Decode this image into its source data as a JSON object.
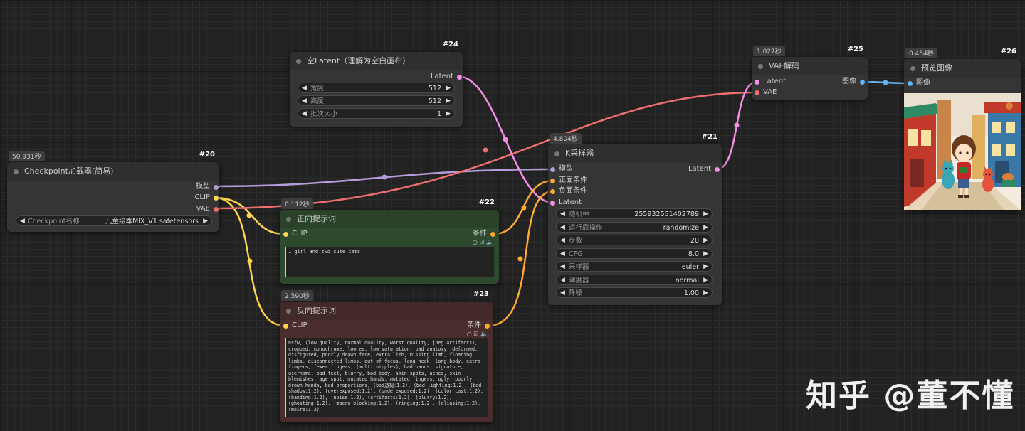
{
  "nodes": {
    "checkpoint": {
      "id": "#20",
      "time": "50.931秒",
      "title": "Checkpoint加载器(简易)",
      "outputs": [
        "模型",
        "CLIP",
        "VAE"
      ],
      "widget": {
        "label": "Checkpoint名称",
        "value": "儿童绘本MIX_V1.safetensors"
      }
    },
    "empty_latent": {
      "id": "#24",
      "title": "空Latent（理解为空白画布）",
      "output": "Latent",
      "widgets": [
        {
          "label": "宽度",
          "value": "512"
        },
        {
          "label": "高度",
          "value": "512"
        },
        {
          "label": "批次大小",
          "value": "1"
        }
      ]
    },
    "positive": {
      "id": "#22",
      "time": "0.112秒",
      "title": "正向提示词",
      "input": "CLIP",
      "output": "条件",
      "text": "1 girl and two cute cats"
    },
    "negative": {
      "id": "#23",
      "time": "2.590秒",
      "title": "反向提示词",
      "input": "CLIP",
      "output": "条件",
      "text": "nsfw, (low quality, normal quality, worst quality, jpeg artifacts), cropped, monochrome, lowres, low saturation, bad anatomy, deformed, disfigured, poorly drawn face, extra limb, missing limb, floating limbs, disconnected limbs, out of focus, long neck, long body, extra fingers, fewer fingers, (multi nipples), bad hands, signature, username, bad feet, blurry, bad body, skin spots, acnes, skin blemishes, age spot, mutated hands, mutated fingers, ugly, poorly drawn hands, bad proportions, (bad透视:1.2), (bad lighting:1.2), (bad shadow:1.2), (overexposed:1.2), (underexposed:1.2), (color cast:1.2), (banding:1.2), (noise:1.2), (artifacts:1.2), (blurry:1.2), (ghosting:1.2), (macro blocking:1.2), (ringing:1.2), (aliasing:1.2), (moire:1.2)"
    },
    "ksampler": {
      "id": "#21",
      "time": "4.804秒",
      "title": "K采样器",
      "inputs": [
        "模型",
        "正面条件",
        "负面条件",
        "Latent"
      ],
      "output": "Latent",
      "widgets": [
        {
          "label": "随机种",
          "value": "255932551402789"
        },
        {
          "label": "运行后操作",
          "value": "randomize"
        },
        {
          "label": "步数",
          "value": "20"
        },
        {
          "label": "CFG",
          "value": "8.0"
        },
        {
          "label": "采样器",
          "value": "euler"
        },
        {
          "label": "调度器",
          "value": "normal"
        },
        {
          "label": "降噪",
          "value": "1.00"
        }
      ]
    },
    "vae_decode": {
      "id": "#25",
      "time": "1.027秒",
      "title": "VAE解码",
      "inputs": [
        "Latent",
        "VAE"
      ],
      "output": "图像"
    },
    "preview": {
      "id": "#26",
      "time": "0.454秒",
      "title": "预览图像",
      "input": "图像"
    }
  },
  "colors": {
    "model": "#b39ddb",
    "clip": "#ffd54f",
    "vae": "#ef6f6f",
    "latent": "#f48fe7",
    "conditioning": "#ffa931",
    "image": "#64b5f6",
    "positive_bg": "#2e4a2e",
    "negative_bg": "#4a2e2e"
  },
  "watermark": "知乎 @董不懂"
}
